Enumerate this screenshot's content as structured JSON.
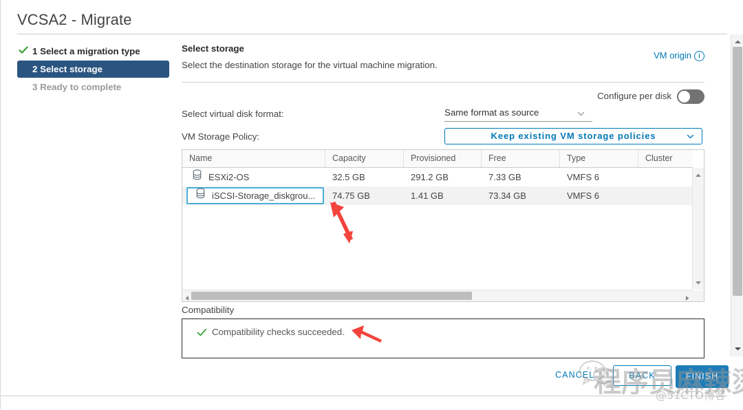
{
  "window": {
    "title": "VCSA2 - Migrate"
  },
  "nav": {
    "items": [
      {
        "label": "1 Select a migration type",
        "state": "done"
      },
      {
        "label": "2 Select storage",
        "state": "active"
      },
      {
        "label": "3 Ready to complete",
        "state": "future"
      }
    ]
  },
  "pane": {
    "heading": "Select storage",
    "description": "Select the destination storage for the virtual machine migration.",
    "vm_origin_link": "VM origin",
    "info_glyph": "i"
  },
  "configure_per_disk": {
    "label": "Configure per disk",
    "state": "off"
  },
  "form": {
    "disk_format_label": "Select virtual disk format:",
    "disk_format_value": "Same format as source",
    "storage_policy_label": "VM Storage Policy:",
    "storage_policy_value": "Keep existing VM storage policies"
  },
  "table": {
    "columns": [
      "Name",
      "Capacity",
      "Provisioned",
      "Free",
      "Type",
      "Cluster"
    ],
    "rows": [
      {
        "name": "ESXi2-OS",
        "capacity": "32.5 GB",
        "provisioned": "291.2 GB",
        "free": "7.33 GB",
        "type": "VMFS 6",
        "cluster": "",
        "selected": false
      },
      {
        "name": "iSCSI-Storage_diskgrou...",
        "capacity": "74.75 GB",
        "provisioned": "1.41 GB",
        "free": "73.34 GB",
        "type": "VMFS 6",
        "cluster": "",
        "selected": true
      }
    ]
  },
  "compatibility": {
    "label": "Compatibility",
    "message": "Compatibility checks succeeded."
  },
  "footer": {
    "cancel_label": "CANCEL",
    "back_label": "BACK",
    "finish_label": "FINISH"
  },
  "watermark": {
    "main": "程序员麻辣烫",
    "sub": "@51CTO博客"
  },
  "colors": {
    "accent_blue": "#0079b8",
    "active_step_bg": "#2b5580",
    "primary_button": "#1d7cb8",
    "selection_border": "#49afd9",
    "success_green": "#3aa238",
    "annotation_red": "#f4433c"
  }
}
